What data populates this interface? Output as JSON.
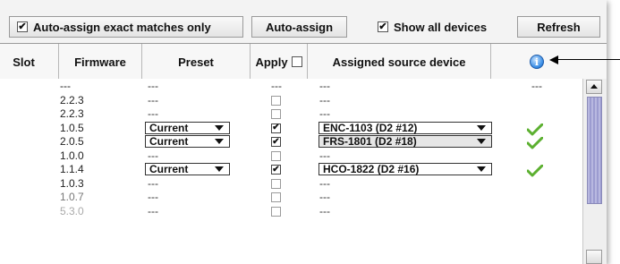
{
  "toolbar": {
    "auto_assign_exact": {
      "label": "Auto-assign exact matches only",
      "checked": true
    },
    "auto_assign_button": "Auto-assign",
    "show_all_devices": {
      "label": "Show all devices",
      "checked": true
    },
    "refresh_button": "Refresh"
  },
  "columns": {
    "slot": "Slot",
    "firmware": "Firmware",
    "preset": "Preset",
    "apply": "Apply",
    "assigned": "Assigned source device"
  },
  "rows": [
    {
      "firmware": "---",
      "preset": "---",
      "apply": "---",
      "assigned": "---",
      "status": "---"
    },
    {
      "firmware": "2.2.3",
      "preset": "---",
      "apply": "",
      "assigned": "---",
      "status": ""
    },
    {
      "firmware": "2.2.3",
      "preset": "---",
      "apply": "",
      "assigned": "---",
      "status": ""
    },
    {
      "firmware": "1.0.5",
      "preset": "Current",
      "apply": "checked",
      "assigned": "ENC-1103 (D2 #12)",
      "status": "ok"
    },
    {
      "firmware": "2.0.5",
      "preset": "Current",
      "apply": "checked",
      "assigned": "FRS-1801 (D2 #18)",
      "status": "ok"
    },
    {
      "firmware": "1.0.0",
      "preset": "---",
      "apply": "",
      "assigned": "---",
      "status": ""
    },
    {
      "firmware": "1.1.4",
      "preset": "Current",
      "apply": "checked",
      "assigned": "HCO-1822 (D2 #16)",
      "status": "ok"
    },
    {
      "firmware": "1.0.3",
      "preset": "---",
      "apply": "",
      "assigned": "---",
      "status": ""
    },
    {
      "firmware": "1.0.7",
      "preset": "---",
      "apply": "",
      "assigned": "---",
      "status": ""
    },
    {
      "firmware": "5.3.0",
      "preset": "---",
      "apply": "",
      "assigned": "---",
      "status": ""
    }
  ],
  "check_glyph": "✔",
  "info_glyph": "i",
  "colors": {
    "ok_check": "#5cb030",
    "info": "#3a8ee6",
    "scroll_thumb": "#b8b8e0"
  }
}
